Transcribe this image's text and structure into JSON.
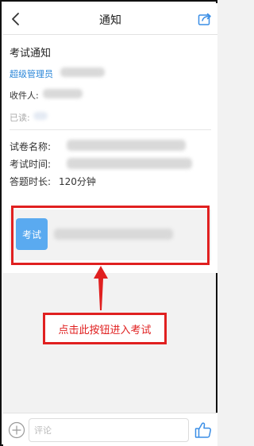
{
  "header": {
    "back_icon": "chevron-left-icon",
    "title": "通知",
    "share_icon": "share-icon"
  },
  "notice": {
    "title": "考试通知",
    "sender_role": "超级管理员",
    "receiver_label": "收件人:",
    "read_label": "已读:",
    "exam_name_label": "试卷名称:",
    "exam_time_label": "考试时间:",
    "duration_label": "答题时长:",
    "duration_value": "120分钟"
  },
  "exam_card": {
    "badge_label": "考试"
  },
  "annotation": {
    "text": "点击此按钮进入考试",
    "color": "#e02020"
  },
  "comment_bar": {
    "plus_icon": "plus-circle-icon",
    "placeholder": "评论",
    "like_icon": "thumbs-up-icon"
  },
  "colors": {
    "link_blue": "#2a86d8",
    "badge_blue": "#5aaaf0",
    "annotation_red": "#e02020"
  }
}
